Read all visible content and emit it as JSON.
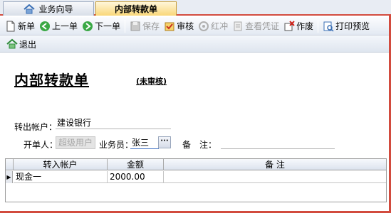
{
  "tabs": [
    {
      "label": "业务向导",
      "active": false
    },
    {
      "label": "内部转款单",
      "active": true
    }
  ],
  "toolbar": {
    "new": "新单",
    "prev": "上一单",
    "next": "下一单",
    "save": "保存",
    "audit": "审核",
    "reverse": "红冲",
    "view_voucher": "查看凭证",
    "void": "作废",
    "print_preview": "打印预览"
  },
  "toolbar2": {
    "exit": "退出"
  },
  "form": {
    "title": "内部转款单",
    "status": "(未审核)",
    "from_account_label": "转出帐户：",
    "from_account_value": "建设银行",
    "creator_label": "开单人：",
    "creator_value": "超级用户",
    "salesman_label": "业务员：",
    "salesman_value": "张三",
    "dots": "···",
    "note_label": "备　注：",
    "note_value": ""
  },
  "grid": {
    "columns": [
      "转入帐户",
      "金额",
      "备 注"
    ],
    "rows": [
      {
        "indicator": "▶",
        "account": "现金一",
        "amount": "2000.00",
        "note": ""
      }
    ]
  },
  "colors": {
    "accent": "#d24b3e",
    "active_tab": "#f9d77a"
  }
}
